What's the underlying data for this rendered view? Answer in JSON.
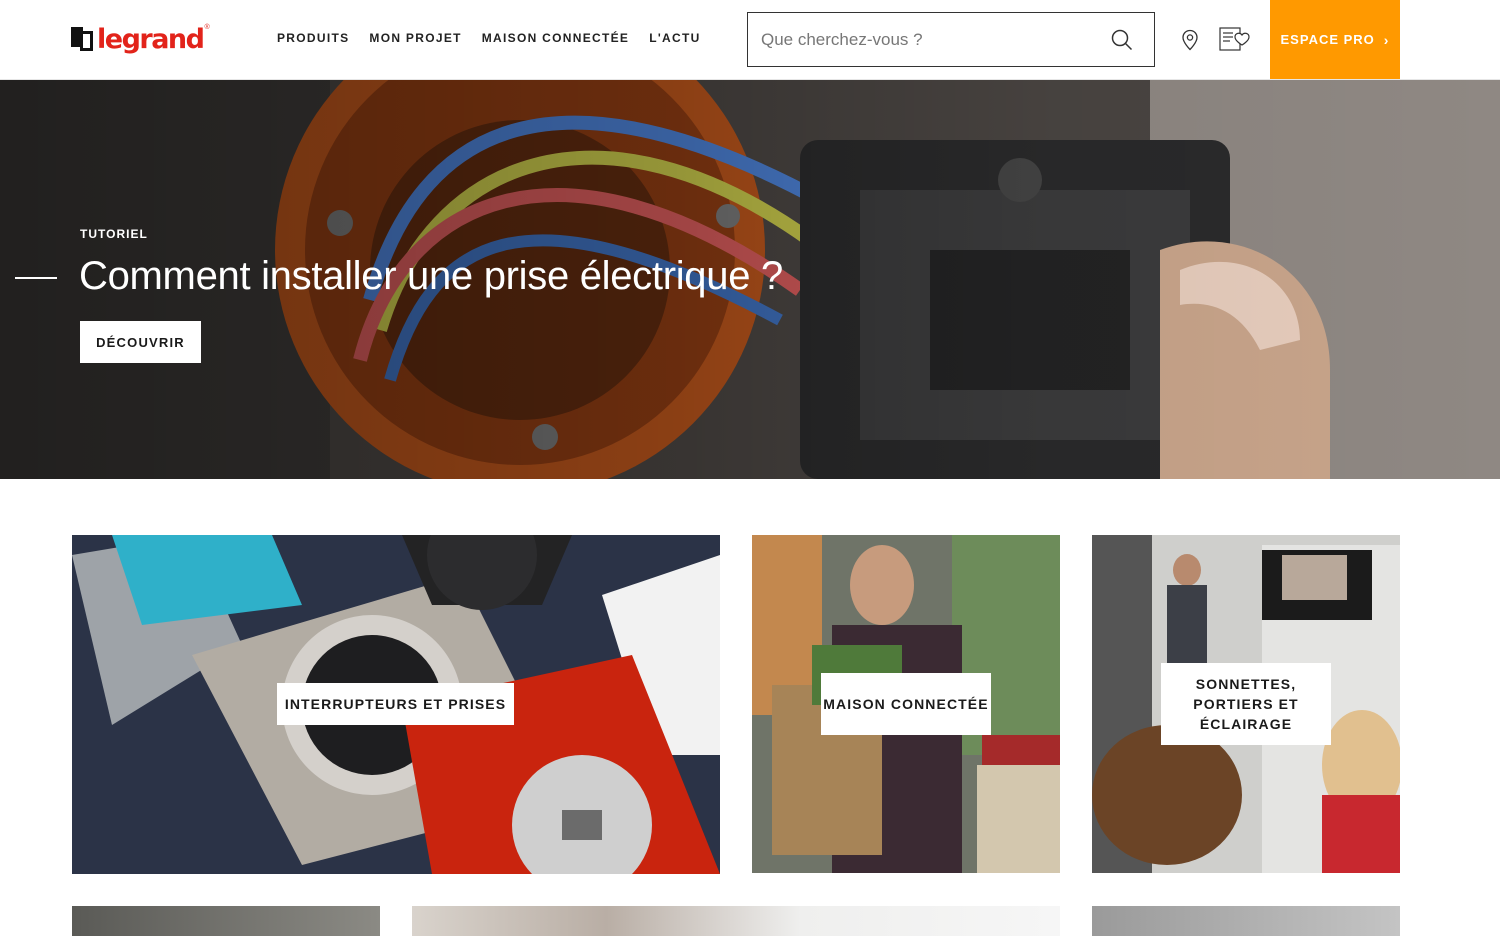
{
  "header": {
    "logo_text": "legrand",
    "logo_reg": "®",
    "nav": [
      "PRODUITS",
      "MON PROJET",
      "MAISON CONNECTÉE",
      "L'ACTU"
    ],
    "search_placeholder": "Que cherchez-vous ?",
    "espace_pro_label": "ESPACE PRO",
    "espace_pro_chevron": "›",
    "icons": [
      "search-icon",
      "location-pin-icon",
      "catalog-heart-icon"
    ],
    "accent_color": "#ff9900",
    "brand_color": "#e2231a"
  },
  "hero": {
    "kicker": "TUTORIEL",
    "title": "Comment installer une prise électrique ?",
    "button_label": "DÉCOUVRIR"
  },
  "categories": [
    {
      "label": "INTERRUPTEURS ET PRISES"
    },
    {
      "label": "MAISON CONNECTÉE"
    },
    {
      "label": "SONNETTES, PORTIERS ET ÉCLAIRAGE"
    }
  ]
}
